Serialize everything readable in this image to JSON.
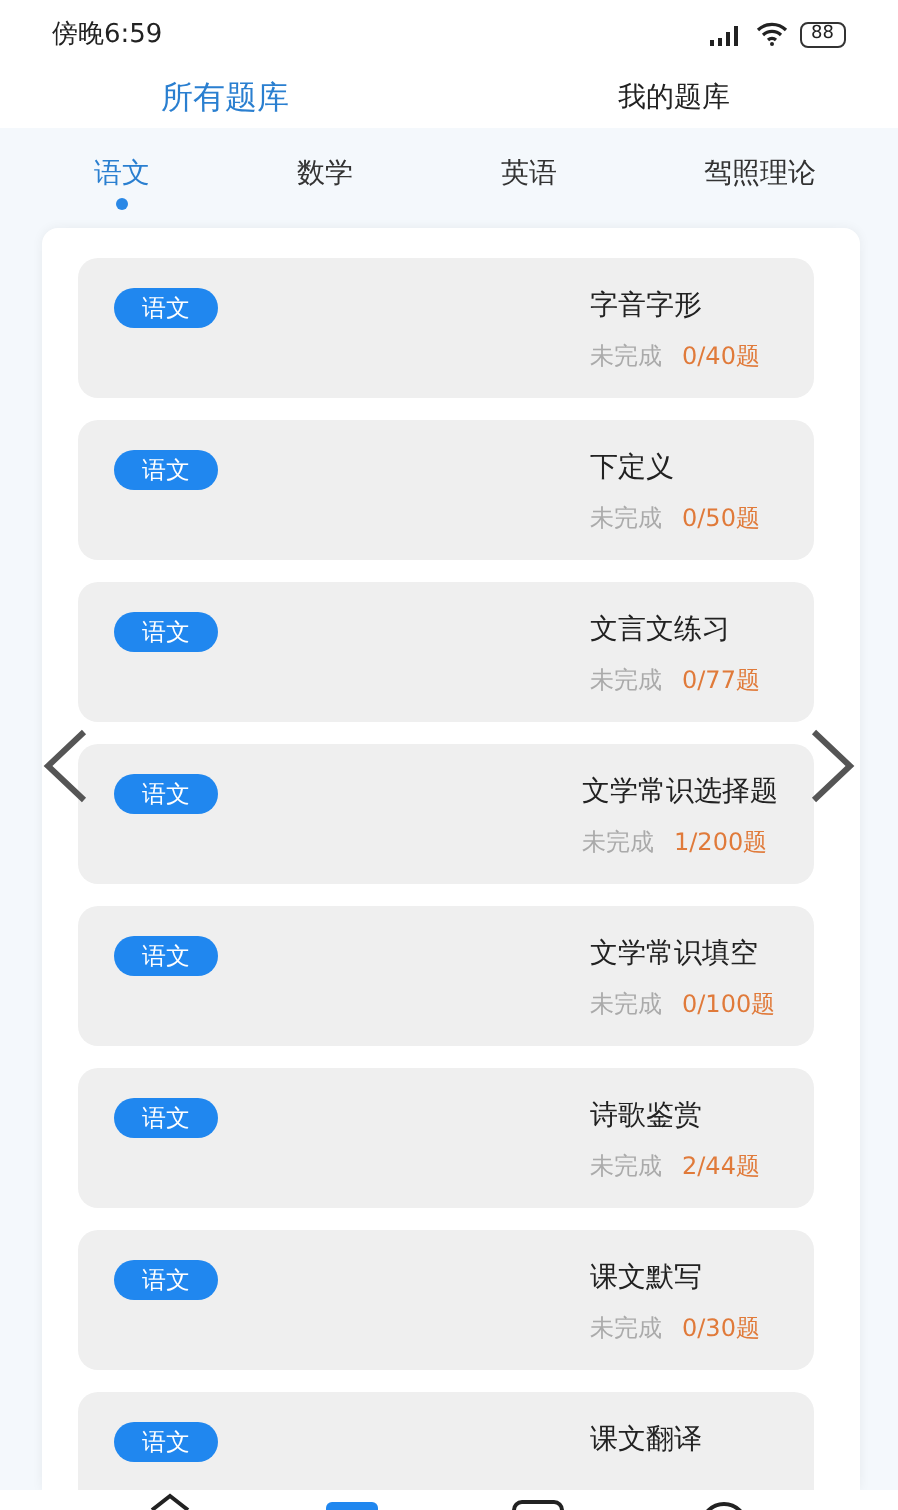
{
  "status_bar": {
    "time": "傍晚6:59",
    "battery": "88"
  },
  "top_tabs": [
    {
      "label": "所有题库",
      "selected": true
    },
    {
      "label": "我的题库",
      "selected": false
    }
  ],
  "subject_tabs": [
    {
      "label": "语文",
      "selected": true
    },
    {
      "label": "数学",
      "selected": false
    },
    {
      "label": "英语",
      "selected": false
    },
    {
      "label": "驾照理论",
      "selected": false
    }
  ],
  "banks": [
    {
      "tag": "语文",
      "title": "字音字形",
      "status": "未完成",
      "progress": "0/40题"
    },
    {
      "tag": "语文",
      "title": "下定义",
      "status": "未完成",
      "progress": "0/50题"
    },
    {
      "tag": "语文",
      "title": "文言文练习",
      "status": "未完成",
      "progress": "0/77题"
    },
    {
      "tag": "语文",
      "title": "文学常识选择题",
      "status": "未完成",
      "progress": "1/200题"
    },
    {
      "tag": "语文",
      "title": "文学常识填空",
      "status": "未完成",
      "progress": "0/100题"
    },
    {
      "tag": "语文",
      "title": "诗歌鉴赏",
      "status": "未完成",
      "progress": "2/44题"
    },
    {
      "tag": "语文",
      "title": "课文默写",
      "status": "未完成",
      "progress": "0/30题"
    },
    {
      "tag": "语文",
      "title": "课文翻译"
    }
  ]
}
